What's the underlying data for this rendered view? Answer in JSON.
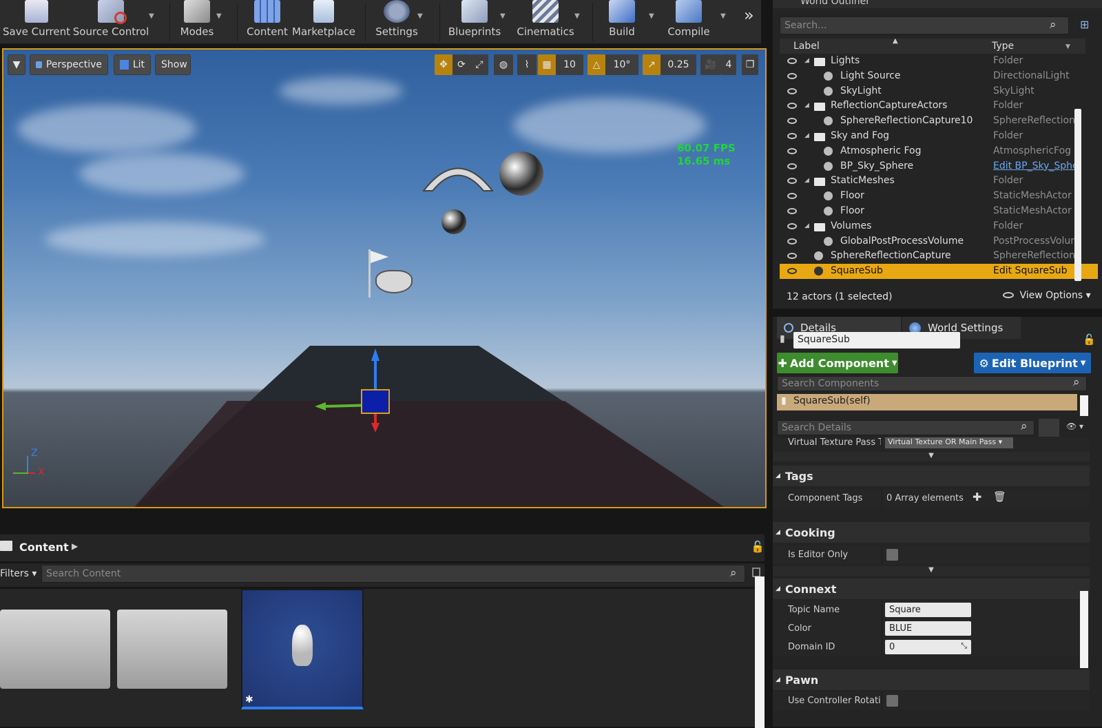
{
  "toolbar": {
    "buttons": [
      {
        "label": "Save Current"
      },
      {
        "label": "Source Control"
      },
      {
        "label": "Modes"
      },
      {
        "label": "Content"
      },
      {
        "label": "Marketplace"
      },
      {
        "label": "Settings"
      },
      {
        "label": "Blueprints"
      },
      {
        "label": "Cinematics"
      },
      {
        "label": "Build"
      },
      {
        "label": "Compile"
      }
    ],
    "more_glyph": "»"
  },
  "viewport": {
    "view_mode": "Perspective",
    "lit_mode": "Lit",
    "show_label": "Show",
    "grid_snap": "10",
    "rotation_snap": "10°",
    "scale_snap": "0.25",
    "camera_speed": "4",
    "fps": "60.07 FPS",
    "frame_ms": "16.65 ms",
    "axis_z": "Z",
    "axis_x": "X"
  },
  "content_browser": {
    "title": "Content",
    "filters_label": "Filters",
    "search_placeholder": "Search Content"
  },
  "outliner": {
    "title": "World Outliner",
    "search_placeholder": "Search...",
    "col_label": "Label",
    "col_type": "Type",
    "rows": [
      {
        "label": "Lights",
        "type": "Folder"
      },
      {
        "label": "Light Source",
        "type": "DirectionalLight"
      },
      {
        "label": "SkyLight",
        "type": "SkyLight"
      },
      {
        "label": "ReflectionCaptureActors",
        "type": "Folder"
      },
      {
        "label": "SphereReflectionCapture10",
        "type": "SphereReflectionCapture"
      },
      {
        "label": "Sky and Fog",
        "type": "Folder"
      },
      {
        "label": "Atmospheric Fog",
        "type": "AtmosphericFog"
      },
      {
        "label": "BP_Sky_Sphere",
        "type": "Edit BP_Sky_Sphere"
      },
      {
        "label": "StaticMeshes",
        "type": "Folder"
      },
      {
        "label": "Floor",
        "type": "StaticMeshActor"
      },
      {
        "label": "Floor",
        "type": "StaticMeshActor"
      },
      {
        "label": "Volumes",
        "type": "Folder"
      },
      {
        "label": "GlobalPostProcessVolume",
        "type": "PostProcessVolume"
      },
      {
        "label": "SphereReflectionCapture",
        "type": "SphereReflectionCapture"
      },
      {
        "label": "SquareSub",
        "type": "Edit SquareSub"
      }
    ],
    "summary": "12 actors (1 selected)",
    "view_options": "View Options"
  },
  "details": {
    "tab_details": "Details",
    "tab_world_settings": "World Settings",
    "actor_name": "SquareSub",
    "add_component": "Add Component",
    "edit_blueprint": "Edit Blueprint",
    "search_components_placeholder": "Search Components",
    "component_self": "SquareSub(self)",
    "search_details_placeholder": "Search Details",
    "vt_pass_label": "Virtual Texture Pass Typ",
    "vt_pass_value": "Virtual Texture OR Main Pass",
    "cat_tags": "Tags",
    "component_tags_label": "Component Tags",
    "component_tags_value": "0 Array elements",
    "cat_cooking": "Cooking",
    "is_editor_only_label": "Is Editor Only",
    "cat_connext": "Connext",
    "topic_name_label": "Topic Name",
    "topic_name_value": "Square",
    "color_label": "Color",
    "color_value": "BLUE",
    "domain_id_label": "Domain ID",
    "domain_id_value": "0",
    "cat_pawn": "Pawn",
    "use_controller_rotation_label": "Use Controller Rotation P"
  },
  "colors": {
    "selection": "#e8a812",
    "add_component": "#3d8c2e",
    "edit_blueprint": "#1c63b4",
    "fps": "#21d43b",
    "component_row": "#c9a97a"
  }
}
